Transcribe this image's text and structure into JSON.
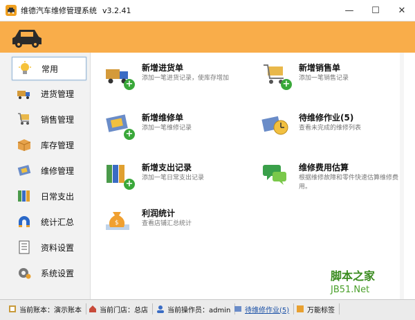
{
  "window": {
    "title": "维德汽车维修管理系统",
    "version": "v3.2.41",
    "minimize_icon": "minimize-icon",
    "maximize_icon": "maximize-icon",
    "close_icon": "close-icon"
  },
  "colors": {
    "banner": "#f9ad4a",
    "accent_green": "#3aa83a",
    "link": "#1a50a6"
  },
  "sidebar": {
    "items": [
      {
        "label": "常用",
        "icon": "lightbulb-icon"
      },
      {
        "label": "进货管理",
        "icon": "truck-icon"
      },
      {
        "label": "销售管理",
        "icon": "cart-icon"
      },
      {
        "label": "库存管理",
        "icon": "box-icon"
      },
      {
        "label": "维修管理",
        "icon": "repair-icon"
      },
      {
        "label": "日常支出",
        "icon": "binders-icon"
      },
      {
        "label": "统计汇总",
        "icon": "magnet-icon"
      },
      {
        "label": "资料设置",
        "icon": "document-icon"
      },
      {
        "label": "系统设置",
        "icon": "gear-icon"
      }
    ]
  },
  "tiles": [
    {
      "title": "新增进货单",
      "sub": "添加一笔进货记录，使库存增加",
      "icon": "truck-add-icon"
    },
    {
      "title": "新增销售单",
      "sub": "添加一笔销售记录",
      "icon": "cart-add-icon"
    },
    {
      "title": "新增维修单",
      "sub": "添加一笔维修记录",
      "icon": "repair-add-icon"
    },
    {
      "title": "待维修作业(5)",
      "sub": "查看未完成的维修列表",
      "icon": "clock-icon"
    },
    {
      "title": "新增支出记录",
      "sub": "添加一笔日常支出记录",
      "icon": "binders-add-icon"
    },
    {
      "title": "维修费用估算",
      "sub": "根据维修故障和零件快速估算维修费用。",
      "icon": "chat-icon"
    },
    {
      "title": "利润统计",
      "sub": "查看店铺汇总统计",
      "icon": "money-bag-icon"
    }
  ],
  "watermark": {
    "line1": "脚本之家",
    "line2": "JB51.Net"
  },
  "statusbar": [
    {
      "label": "当前账本：演示账本",
      "icon": "ledger-icon"
    },
    {
      "label": "当前门店：总店",
      "icon": "store-icon"
    },
    {
      "label": "当前操作员：admin",
      "icon": "user-icon"
    },
    {
      "label": "待维修作业(5)",
      "icon": "wrench-icon"
    },
    {
      "label": "万能标签",
      "icon": "tag-icon"
    }
  ]
}
